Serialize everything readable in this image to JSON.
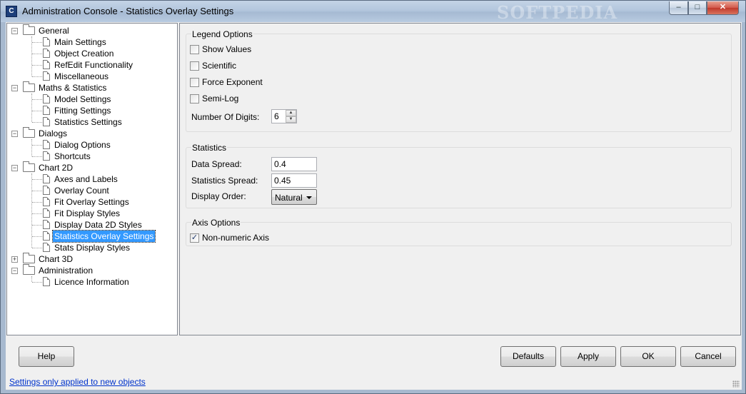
{
  "window": {
    "title": "Administration Console - Statistics Overlay Settings",
    "icon_letter": "C",
    "watermark": "SOFTPEDIA",
    "controls": {
      "minimize": "–",
      "maximize": "□",
      "close": "✕"
    }
  },
  "tree": {
    "groups": [
      {
        "label": "General",
        "expanded": true,
        "items": [
          "Main Settings",
          "Object Creation",
          "RefEdit Functionality",
          "Miscellaneous"
        ]
      },
      {
        "label": "Maths & Statistics",
        "expanded": true,
        "items": [
          "Model Settings",
          "Fitting Settings",
          "Statistics Settings"
        ]
      },
      {
        "label": "Dialogs",
        "expanded": true,
        "items": [
          "Dialog Options",
          "Shortcuts"
        ]
      },
      {
        "label": "Chart 2D",
        "expanded": true,
        "items": [
          "Axes and Labels",
          "Overlay Count",
          "Fit Overlay Settings",
          "Fit Display Styles",
          "Display Data 2D Styles",
          "Statistics Overlay Settings",
          "Stats Display Styles"
        ]
      },
      {
        "label": "Chart 3D",
        "expanded": false,
        "items": []
      },
      {
        "label": "Administration",
        "expanded": true,
        "items": [
          "Licence Information"
        ]
      }
    ],
    "selected": "Statistics Overlay Settings"
  },
  "legend_options": {
    "title": "Legend Options",
    "show_values": {
      "label": "Show Values",
      "checked": false
    },
    "scientific": {
      "label": "Scientific",
      "checked": false
    },
    "force_exponent": {
      "label": "Force Exponent",
      "checked": false
    },
    "semi_log": {
      "label": "Semi-Log",
      "checked": false
    },
    "digits_label": "Number Of Digits:",
    "digits_value": "6"
  },
  "statistics": {
    "title": "Statistics",
    "data_spread_label": "Data Spread:",
    "data_spread_value": "0.4",
    "stats_spread_label": "Statistics Spread:",
    "stats_spread_value": "0.45",
    "display_order_label": "Display Order:",
    "display_order_value": "Natural"
  },
  "axis_options": {
    "title": "Axis Options",
    "non_numeric": {
      "label": "Non-numeric Axis",
      "checked": true
    }
  },
  "buttons": {
    "help": "Help",
    "defaults": "Defaults",
    "apply": "Apply",
    "ok": "OK",
    "cancel": "Cancel"
  },
  "status": {
    "link_text": "Settings only applied to new objects"
  }
}
